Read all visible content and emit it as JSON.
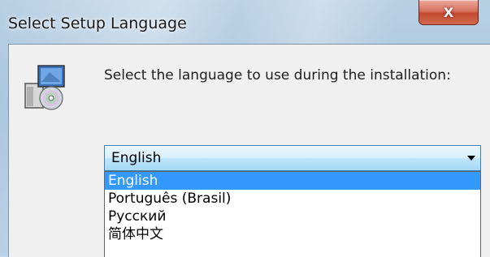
{
  "window": {
    "title": "Select Setup Language",
    "close_glyph": "X"
  },
  "dialog": {
    "prompt": "Select the language to use during the installation:",
    "icon": "setup-installer-icon",
    "language_select": {
      "selected": "English",
      "options": [
        "English",
        "Português (Brasil)",
        "Русский",
        "简体中文"
      ],
      "highlighted_option": "English"
    }
  },
  "colors": {
    "highlight": "#3399ff",
    "close_button": "#c34a2f",
    "client_bg": "#f0f0f0"
  }
}
